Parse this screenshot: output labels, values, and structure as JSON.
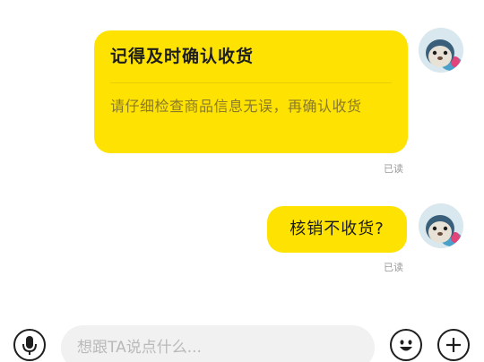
{
  "messages": [
    {
      "title": "记得及时确认收货",
      "body": "请仔细检查商品信息无误，再确认收货",
      "status": "已读"
    },
    {
      "text": "核销不收货?",
      "status": "已读"
    }
  ],
  "input": {
    "placeholder": "想跟TA说点什么..."
  },
  "icons": {
    "voice": "microphone-icon",
    "emoji": "emoji-icon",
    "more": "plus-icon"
  },
  "colors": {
    "bubble": "#fee202",
    "read_status": "#9a9a9a",
    "input_bg": "#f1f1f1"
  }
}
